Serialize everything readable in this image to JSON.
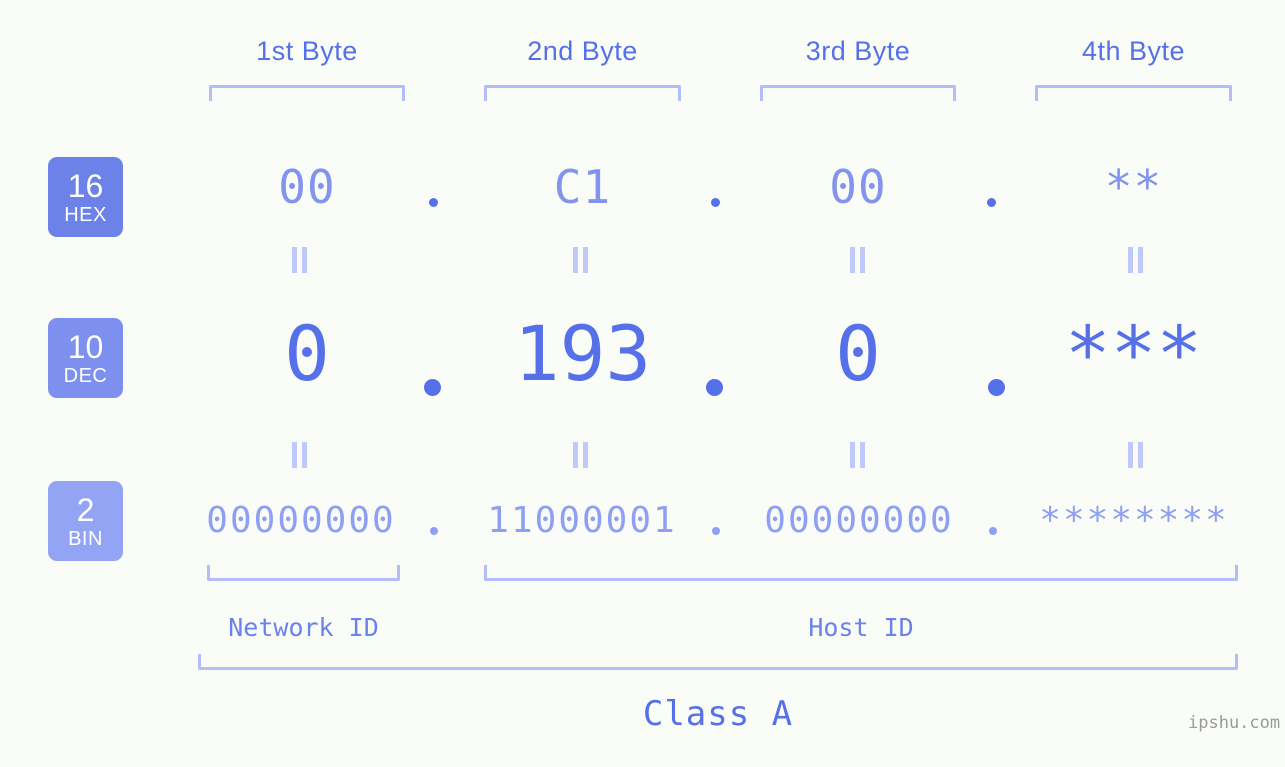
{
  "meta": {
    "background_color": "#fafdf7",
    "accent_color": "#5570e8",
    "bracket_color": "#b2bdfa",
    "watermark": "ipshu.com"
  },
  "byte_headers": [
    {
      "label": "1st Byte"
    },
    {
      "label": "2nd Byte"
    },
    {
      "label": "3rd Byte"
    },
    {
      "label": "4th Byte"
    }
  ],
  "bases": [
    {
      "num": "16",
      "label": "HEX",
      "color": "#6d82e8"
    },
    {
      "num": "10",
      "label": "DEC",
      "color": "#7d8fef"
    },
    {
      "num": "2",
      "label": "BIN",
      "color": "#93a4f5"
    }
  ],
  "rows": {
    "hex": {
      "bytes": [
        "00",
        "C1",
        "00",
        "**"
      ],
      "separator": "."
    },
    "dec": {
      "bytes": [
        "0",
        "193",
        "0",
        "***"
      ],
      "separator": "."
    },
    "bin": {
      "bytes": [
        "00000000",
        "11000001",
        "00000000",
        "********"
      ],
      "separator": "."
    }
  },
  "equals_symbol": "=",
  "segments": {
    "network_id": "Network ID",
    "host_id": "Host ID",
    "class": "Class A"
  }
}
